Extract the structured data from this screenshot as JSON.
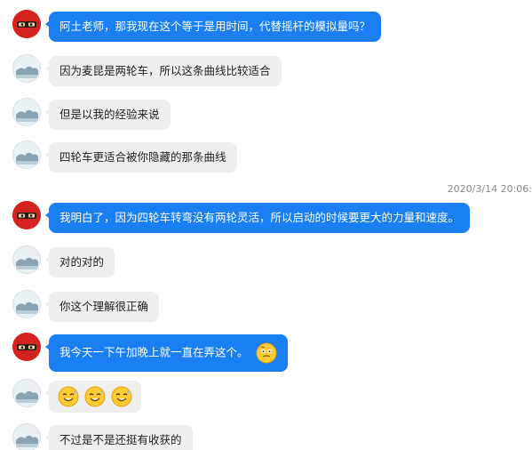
{
  "messages": [
    {
      "sender": "ninja",
      "text": "阿土老师，那我现在这个等于是用时间，代替摇杆的模拟量吗？"
    },
    {
      "sender": "landscape",
      "text": "因为麦昆是两轮车，所以这条曲线比较适合"
    },
    {
      "sender": "landscape",
      "text": "但是以我的经验来说"
    },
    {
      "sender": "landscape",
      "text": "四轮车更适合被你隐藏的那条曲线"
    },
    {
      "sender": "ninja",
      "text": "我明白了，因为四轮车转弯没有两轮灵活，所以启动的时候要更大的力量和速度。"
    },
    {
      "sender": "landscape",
      "text": "对的对的"
    },
    {
      "sender": "landscape",
      "text": "你这个理解很正确"
    },
    {
      "sender": "ninja",
      "text": "我今天一下午加晚上就一直在弄这个。",
      "emoji": "thinking-face-icon"
    },
    {
      "sender": "landscape",
      "emojis": [
        "grinning-sweat-icon",
        "grinning-sweat-icon",
        "grinning-sweat-icon"
      ]
    },
    {
      "sender": "landscape",
      "text": "不过是不是还挺有收获的"
    }
  ],
  "timestamp": "2020/3/14 20:06:",
  "colors": {
    "blue_bubble": "#1a7ff2",
    "grey_bubble": "#efefef",
    "timestamp_text": "#8a8a8a"
  }
}
